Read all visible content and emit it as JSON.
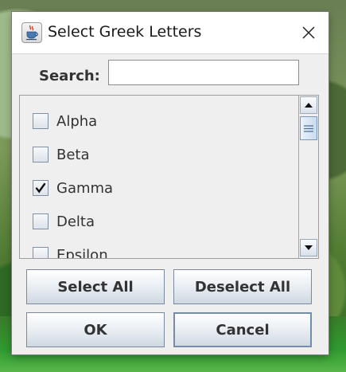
{
  "window": {
    "title": "Select Greek Letters",
    "app_icon": "java-cup-icon",
    "close_icon": "close-icon"
  },
  "search": {
    "label": "Search:",
    "value": "",
    "placeholder": ""
  },
  "list": {
    "items": [
      {
        "label": "Alpha",
        "checked": false
      },
      {
        "label": "Beta",
        "checked": false
      },
      {
        "label": "Gamma",
        "checked": true
      },
      {
        "label": "Delta",
        "checked": false
      },
      {
        "label": "Epsilon",
        "checked": false
      }
    ],
    "check_mark": "🗸"
  },
  "buttons": {
    "select_all": "Select All",
    "deselect_all": "Deselect All",
    "ok": "OK",
    "cancel": "Cancel"
  },
  "colors": {
    "dialog_bg": "#efefef",
    "titlebar_bg": "#ffffff",
    "button_border": "#7a8a9c",
    "scroll_thumb": "#c9dbee"
  }
}
